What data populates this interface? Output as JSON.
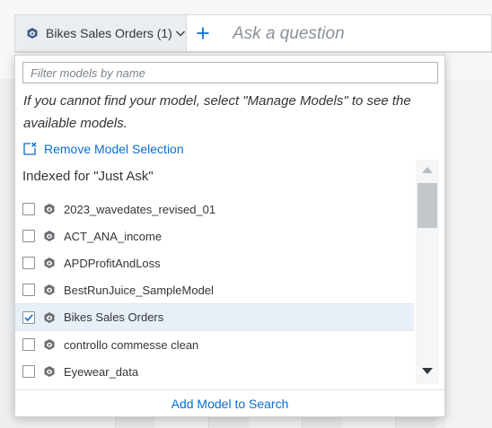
{
  "query_bar": {
    "model_button_label": "Bikes Sales Orders (1)",
    "ask_placeholder": "Ask a question"
  },
  "popover": {
    "filter_placeholder": "Filter models by name",
    "hint": "If you cannot find your model, select \"Manage Models\" to see the available models.",
    "remove_selection_label": "Remove Model Selection",
    "section_title": "Indexed for \"Just Ask\"",
    "models": [
      {
        "label": "2023_wavedates_revised_01",
        "checked": false
      },
      {
        "label": "ACT_ANA_income",
        "checked": false
      },
      {
        "label": "APDProfitAndLoss",
        "checked": false
      },
      {
        "label": "BestRunJuice_SampleModel",
        "checked": false
      },
      {
        "label": "Bikes Sales Orders",
        "checked": true
      },
      {
        "label": "controllo commesse clean",
        "checked": false
      },
      {
        "label": "Eyewear_data",
        "checked": false
      }
    ],
    "add_model_label": "Add Model to Search"
  },
  "colors": {
    "accent": "#0a6ed1",
    "text": "#32363a",
    "selected_row": "#e8eff6",
    "model_icon": "#3f5b8a"
  },
  "icons": {
    "model": "model-cube-icon",
    "chevron": "chevron-down-icon",
    "remove": "remove-selection-icon",
    "checkmark": "checkmark-icon"
  }
}
